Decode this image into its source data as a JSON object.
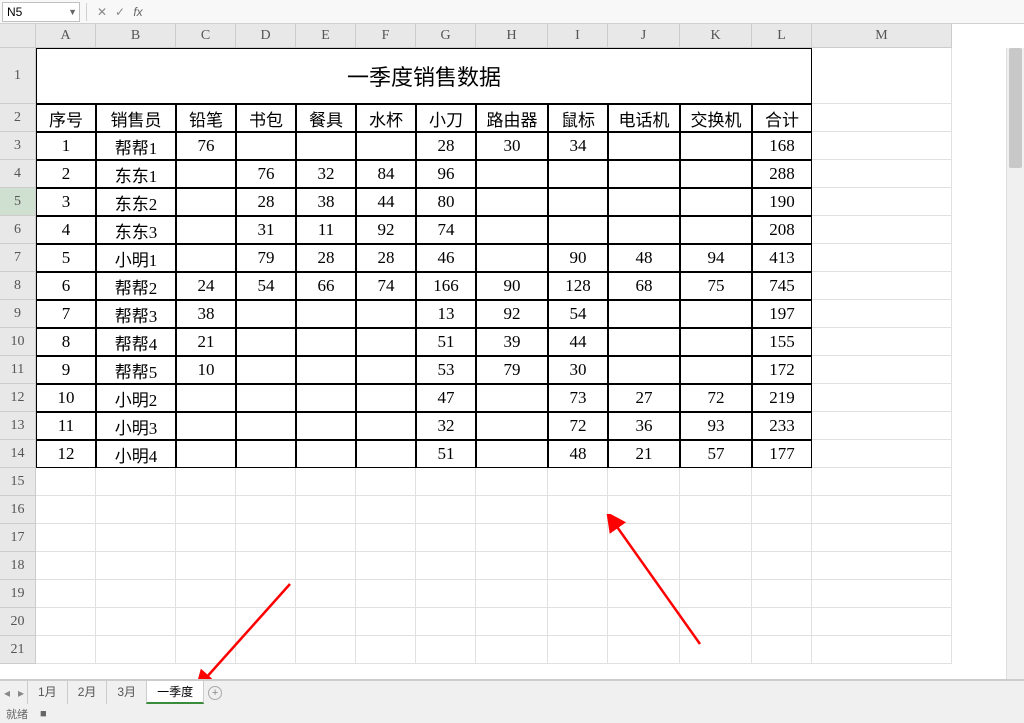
{
  "name_box": "N5",
  "formula": "",
  "col_widths": {
    "A": 60,
    "B": 80,
    "C": 60,
    "D": 60,
    "E": 60,
    "F": 60,
    "G": 60,
    "H": 72,
    "I": 60,
    "J": 72,
    "K": 72,
    "L": 60,
    "M": 140
  },
  "columns": [
    "A",
    "B",
    "C",
    "D",
    "E",
    "F",
    "G",
    "H",
    "I",
    "J",
    "K",
    "L",
    "M"
  ],
  "rows_visible": 21,
  "row1_height": 56,
  "selected_row": 5,
  "title": "一季度销售数据",
  "chart_data": {
    "type": "table",
    "title": "一季度销售数据",
    "headers": [
      "序号",
      "销售员",
      "铅笔",
      "书包",
      "餐具",
      "水杯",
      "小刀",
      "路由器",
      "鼠标",
      "电话机",
      "交换机",
      "合计"
    ],
    "rows": [
      {
        "序号": 1,
        "销售员": "帮帮1",
        "铅笔": 76,
        "书包": null,
        "餐具": null,
        "水杯": null,
        "小刀": 28,
        "路由器": 30,
        "鼠标": 34,
        "电话机": null,
        "交换机": null,
        "合计": 168
      },
      {
        "序号": 2,
        "销售员": "东东1",
        "铅笔": null,
        "书包": 76,
        "餐具": 32,
        "水杯": 84,
        "小刀": 96,
        "路由器": null,
        "鼠标": null,
        "电话机": null,
        "交换机": null,
        "合计": 288
      },
      {
        "序号": 3,
        "销售员": "东东2",
        "铅笔": null,
        "书包": 28,
        "餐具": 38,
        "水杯": 44,
        "小刀": 80,
        "路由器": null,
        "鼠标": null,
        "电话机": null,
        "交换机": null,
        "合计": 190
      },
      {
        "序号": 4,
        "销售员": "东东3",
        "铅笔": null,
        "书包": 31,
        "餐具": 11,
        "水杯": 92,
        "小刀": 74,
        "路由器": null,
        "鼠标": null,
        "电话机": null,
        "交换机": null,
        "合计": 208
      },
      {
        "序号": 5,
        "销售员": "小明1",
        "铅笔": null,
        "书包": 79,
        "餐具": 28,
        "水杯": 28,
        "小刀": 46,
        "路由器": null,
        "鼠标": 90,
        "电话机": 48,
        "交换机": 94,
        "合计": 413
      },
      {
        "序号": 6,
        "销售员": "帮帮2",
        "铅笔": 24,
        "书包": 54,
        "餐具": 66,
        "水杯": 74,
        "小刀": 166,
        "路由器": 90,
        "鼠标": 128,
        "电话机": 68,
        "交换机": 75,
        "合计": 745
      },
      {
        "序号": 7,
        "销售员": "帮帮3",
        "铅笔": 38,
        "书包": null,
        "餐具": null,
        "水杯": null,
        "小刀": 13,
        "路由器": 92,
        "鼠标": 54,
        "电话机": null,
        "交换机": null,
        "合计": 197
      },
      {
        "序号": 8,
        "销售员": "帮帮4",
        "铅笔": 21,
        "书包": null,
        "餐具": null,
        "水杯": null,
        "小刀": 51,
        "路由器": 39,
        "鼠标": 44,
        "电话机": null,
        "交换机": null,
        "合计": 155
      },
      {
        "序号": 9,
        "销售员": "帮帮5",
        "铅笔": 10,
        "书包": null,
        "餐具": null,
        "水杯": null,
        "小刀": 53,
        "路由器": 79,
        "鼠标": 30,
        "电话机": null,
        "交换机": null,
        "合计": 172
      },
      {
        "序号": 10,
        "销售员": "小明2",
        "铅笔": null,
        "书包": null,
        "餐具": null,
        "水杯": null,
        "小刀": 47,
        "路由器": null,
        "鼠标": 73,
        "电话机": 27,
        "交换机": 72,
        "合计": 219
      },
      {
        "序号": 11,
        "销售员": "小明3",
        "铅笔": null,
        "书包": null,
        "餐具": null,
        "水杯": null,
        "小刀": 32,
        "路由器": null,
        "鼠标": 72,
        "电话机": 36,
        "交换机": 93,
        "合计": 233
      },
      {
        "序号": 12,
        "销售员": "小明4",
        "铅笔": null,
        "书包": null,
        "餐具": null,
        "水杯": null,
        "小刀": 51,
        "路由器": null,
        "鼠标": 48,
        "电话机": 21,
        "交换机": 57,
        "合计": 177
      }
    ]
  },
  "sheet_tabs": [
    "1月",
    "2月",
    "3月",
    "一季度"
  ],
  "active_tab": 3,
  "status": {
    "s1": "就绪",
    "s2": "■"
  }
}
